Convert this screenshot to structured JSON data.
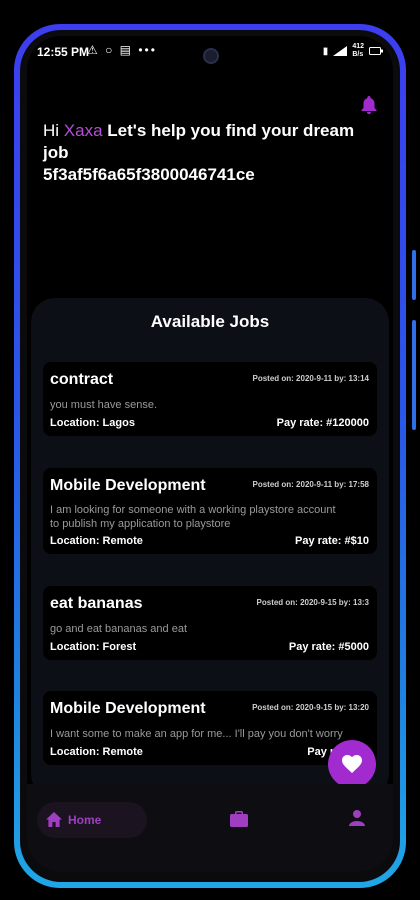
{
  "status_bar": {
    "time": "12:55 PM",
    "notif_icons": "⚠ ○ ▤ •••",
    "net_speed_top": "412",
    "net_speed_bottom": "B/s"
  },
  "header": {
    "hi": "Hi",
    "user_name": "Xaxa",
    "tagline": "Let's help you find your dream job",
    "user_id": "5f3af5f6a65f3800046741ce"
  },
  "jobs_panel": {
    "title": "Available Jobs",
    "jobs": [
      {
        "title": "contract",
        "posted": "Posted on: 2020-9-11 by: 13:14",
        "description": [
          "you must have sense."
        ],
        "location": "Location: Lagos",
        "pay": "Pay rate: #120000"
      },
      {
        "title": "Mobile Development",
        "posted": "Posted on: 2020-9-11 by: 17:58",
        "description": [
          "I am looking for someone with a working playstore account",
          "to publish my application to playstore"
        ],
        "location": "Location: Remote",
        "pay": "Pay rate: #$10"
      },
      {
        "title": "eat bananas",
        "posted": "Posted on: 2020-9-15 by: 13:3",
        "description": [
          "go and eat bananas and eat"
        ],
        "location": "Location: Forest",
        "pay": "Pay rate: #5000"
      },
      {
        "title": "Mobile Development",
        "posted": "Posted on: 2020-9-15 by: 13:20",
        "description": [
          "I want some to make an app for me... I'll pay you don't worry"
        ],
        "location": "Location: Remote",
        "pay": "Pay rate: #6"
      }
    ]
  },
  "bottom_nav": {
    "home_label": "Home"
  },
  "colors": {
    "accent": "#a22bd0",
    "frame_gradient_top": "#3d3ef0",
    "frame_gradient_bottom": "#20a6e6"
  },
  "icons": [
    "bell-icon",
    "heart-icon",
    "home-icon",
    "briefcase-icon",
    "person-icon"
  ]
}
